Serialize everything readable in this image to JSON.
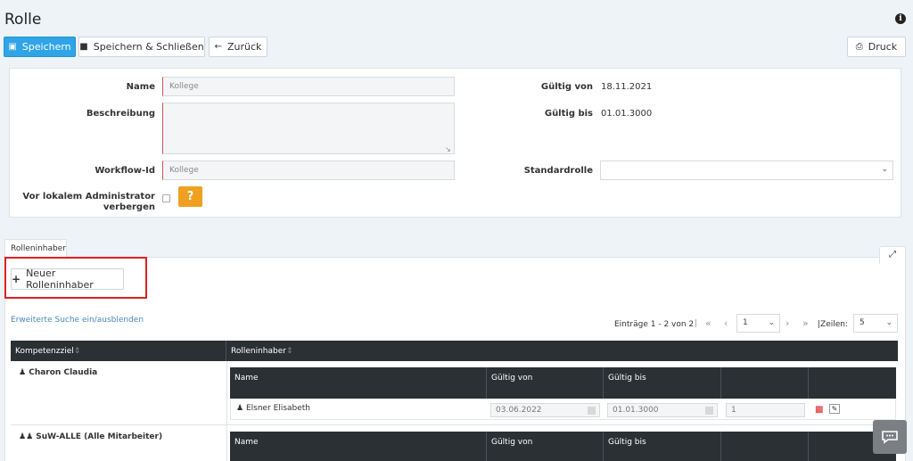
{
  "page": {
    "title": "Rolle"
  },
  "toolbar": {
    "save_label": "Speichern",
    "save_close_label": "Speichern & Schließen",
    "back_label": "Zurück",
    "print_label": "Druck"
  },
  "form": {
    "name_label": "Name",
    "name_value": "Kollege",
    "description_label": "Beschreibung",
    "description_value": "",
    "workflow_label": "Workflow-Id",
    "workflow_value": "Kollege",
    "hide_label_line1": "Vor lokalem Administrator",
    "hide_label_line2": "verbergen",
    "help_glyph": "?",
    "valid_from_label": "Gültig von",
    "valid_from_value": "18.11.2021",
    "valid_to_label": "Gültig bis",
    "valid_to_value": "01.01.3000",
    "default_role_label": "Standardrolle",
    "default_role_value": ""
  },
  "tabs": {
    "role_holders": "Rolleninhaber"
  },
  "role_holders": {
    "new_button_label": "Neuer Rolleninhaber",
    "advanced_search_link": "Erweiterte Suche ein/ausblenden",
    "pager": {
      "entries_text": "Einträge 1 - 2 von 2",
      "page_value": "1",
      "rows_label": "|Zeilen:",
      "rows_value": "5"
    },
    "columns": [
      "Kompetenzziel",
      "Rolleninhaber"
    ],
    "groups": [
      {
        "name": "Charon Claudia",
        "sub_columns": [
          "Name",
          "Gültig von",
          "Gültig bis",
          "",
          ""
        ],
        "rows": [
          {
            "name": "Elsner Elisabeth",
            "valid_from": "03.06.2022",
            "valid_to": "01.01.3000",
            "order": "1"
          }
        ]
      },
      {
        "name": "SuW-ALLE (Alle Mitarbeiter)",
        "sub_columns": [
          "Name",
          "Gültig von",
          "Gültig bis",
          "",
          ""
        ],
        "rows": []
      }
    ]
  },
  "colors": {
    "primary": "#2fa4e7",
    "help": "#f0a020",
    "header_dark": "#2b3034",
    "highlight_border": "#e02020"
  }
}
